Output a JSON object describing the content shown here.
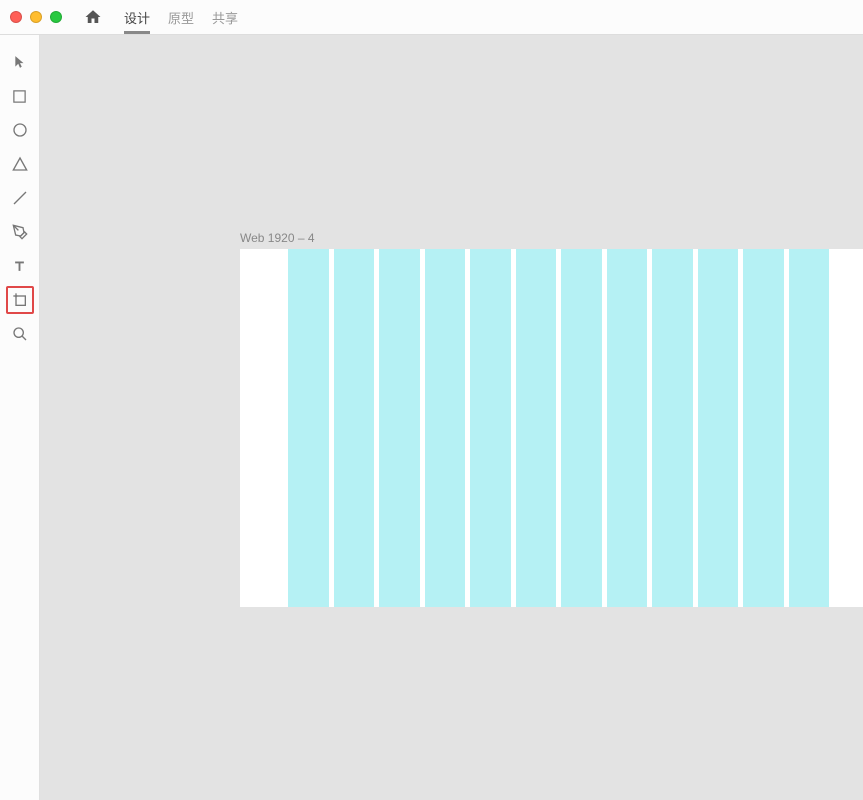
{
  "titlebar": {
    "tabs": [
      {
        "label": "设计",
        "active": true
      },
      {
        "label": "原型",
        "active": false
      },
      {
        "label": "共享",
        "active": false
      }
    ]
  },
  "toolbar": {
    "tools": [
      {
        "name": "select-tool"
      },
      {
        "name": "rectangle-tool"
      },
      {
        "name": "ellipse-tool"
      },
      {
        "name": "polygon-tool"
      },
      {
        "name": "line-tool"
      },
      {
        "name": "pen-tool"
      },
      {
        "name": "text-tool"
      },
      {
        "name": "artboard-tool",
        "highlighted": true
      },
      {
        "name": "zoom-tool"
      }
    ]
  },
  "canvas": {
    "artboard_label": "Web 1920 – 4",
    "grid_columns": 12,
    "grid_color": "#b5f1f4"
  }
}
